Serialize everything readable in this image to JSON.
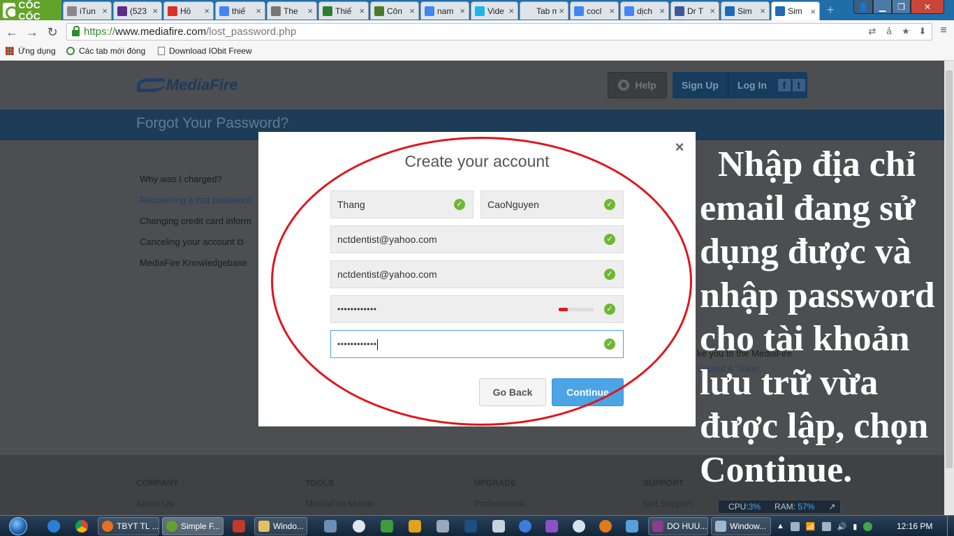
{
  "browser": {
    "brand": "CỐC CỐC",
    "tabs": [
      {
        "label": "iTun",
        "icon": "apple-icon",
        "color": "#888888"
      },
      {
        "label": "(523",
        "icon": "mail-icon",
        "color": "#5b2c8a"
      },
      {
        "label": "Hồ",
        "icon": "gmail-icon",
        "color": "#d93025"
      },
      {
        "label": "thiế",
        "icon": "google-icon",
        "color": "#4285f4"
      },
      {
        "label": "The",
        "icon": "page-icon",
        "color": "#777777"
      },
      {
        "label": "Thiế",
        "icon": "shield-icon",
        "color": "#2e7d32"
      },
      {
        "label": "Côn",
        "icon": "leaf-icon",
        "color": "#4a7a2a"
      },
      {
        "label": "nam",
        "icon": "google-icon",
        "color": "#4285f4"
      },
      {
        "label": "Vide",
        "icon": "vimeo-icon",
        "color": "#1ab7ea"
      },
      {
        "label": "Tab mớ",
        "icon": "blank-icon",
        "color": "#dfe4ea"
      },
      {
        "label": "cocl",
        "icon": "google-icon",
        "color": "#4285f4"
      },
      {
        "label": "dịch",
        "icon": "google-icon",
        "color": "#4285f4"
      },
      {
        "label": "Dr T",
        "icon": "facebook-icon",
        "color": "#3b5998"
      },
      {
        "label": "Sim",
        "icon": "mediafire-icon",
        "color": "#1c6bb6"
      },
      {
        "label": "Sim",
        "icon": "mediafire-icon",
        "color": "#1c6bb6"
      }
    ],
    "url": {
      "scheme": "https://",
      "host": "www.mediafire.com",
      "path": "/lost_password.php"
    },
    "bookmarks": [
      {
        "label": "Ứng dụng",
        "icon": "apps-icon"
      },
      {
        "label": "Các tab mới đóng",
        "icon": "recent-tabs-icon"
      },
      {
        "label": "Download IObit Freew",
        "icon": "page-icon"
      }
    ]
  },
  "site": {
    "logo": "MediaFire",
    "help": "Help",
    "signup": "Sign Up",
    "login": "Log In",
    "banner_title": "Forgot Your Password?",
    "sidenav": [
      "Why was I charged?",
      "Recovering a lost password",
      "Changing credit card inform",
      "Canceling your account",
      "MediaFire Knowledgebase"
    ],
    "bg_note": "ke you to the MediaFire",
    "bg_link": "Submit A Ticket",
    "footer": [
      {
        "heading": "COMPANY",
        "link": "About Us"
      },
      {
        "heading": "TOOLS",
        "link": "MediaFire Mobile"
      },
      {
        "heading": "UPGRADE",
        "link": "Professional"
      },
      {
        "heading": "SUPPORT",
        "link": "Get Support"
      }
    ]
  },
  "modal": {
    "title": "Create your account",
    "first_name": "Thang",
    "last_name": "CaoNguyen",
    "email": "nctdentist@yahoo.com",
    "email_confirm": "nctdentist@yahoo.com",
    "password_mask": "••••••••••••",
    "password_confirm_mask": "••••••••••••",
    "password_strength": 0.25,
    "back_label": "Go Back",
    "continue_label": "Continue"
  },
  "annotation": {
    "text": "  Nhập địa chỉ\nemail đang sử\ndụng được và\nnhập password\ncho tài khoản\nlưu trữ vừa\nđược lập, chọn\nContinue.",
    "circle_color": "#e2141b"
  },
  "sysmon": {
    "cpu_label": "CPU:",
    "cpu": "3%",
    "ram_label": "RAM:",
    "ram": "57%"
  },
  "taskbar": {
    "items": [
      {
        "label": "TBYT TL ...",
        "icon": "firefox-icon"
      },
      {
        "label": "Simple F...",
        "icon": "coccoc-icon"
      },
      {
        "label": "Windo...",
        "icon": "folder-icon"
      },
      {
        "label": "DO HUU...",
        "icon": "winrar-icon"
      },
      {
        "label": "Window...",
        "icon": "window-icon"
      }
    ],
    "clock": "12:16 PM"
  }
}
